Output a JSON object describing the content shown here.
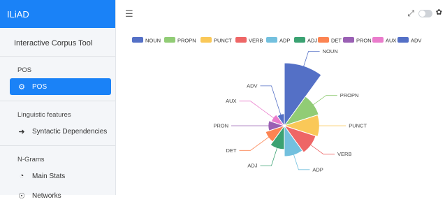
{
  "app": {
    "brand": "ILiAD",
    "subtitle": "Interactive Corpus Tool"
  },
  "sidebar": {
    "sections": [
      {
        "title": "POS",
        "items": [
          {
            "label": "POS",
            "icon": "pos-icon",
            "active": true
          }
        ]
      },
      {
        "title": "Linguistic features",
        "items": [
          {
            "label": "Syntactic Dependencies",
            "icon": "arrow-right-icon"
          }
        ]
      },
      {
        "title": "N-Grams",
        "items": [
          {
            "label": "Main Stats",
            "icon": "pie-chart-icon"
          },
          {
            "label": "Networks",
            "icon": "network-icon"
          }
        ]
      }
    ]
  },
  "topbar": {
    "menu_icon": "hamburger-icon",
    "expand_icon": "expand-icon",
    "toggle_icon": "dark-mode-toggle",
    "settings_icon": "gear-icon"
  },
  "colors": {
    "accent": "#1a82f7"
  },
  "chart_data": {
    "type": "pie",
    "variant": "rose",
    "legend_position": "top",
    "categories": [
      "NOUN",
      "PROPN",
      "PUNCT",
      "VERB",
      "ADP",
      "ADJ",
      "DET",
      "PRON",
      "AUX",
      "ADV"
    ],
    "values": [
      100,
      42,
      40,
      36,
      32,
      20,
      14,
      9,
      6,
      4
    ],
    "colors": [
      "#5470c6",
      "#91cc75",
      "#fac858",
      "#ee6666",
      "#73c0de",
      "#3ba272",
      "#fc8452",
      "#9a60b4",
      "#ea7ccc",
      "#5470c6"
    ]
  }
}
